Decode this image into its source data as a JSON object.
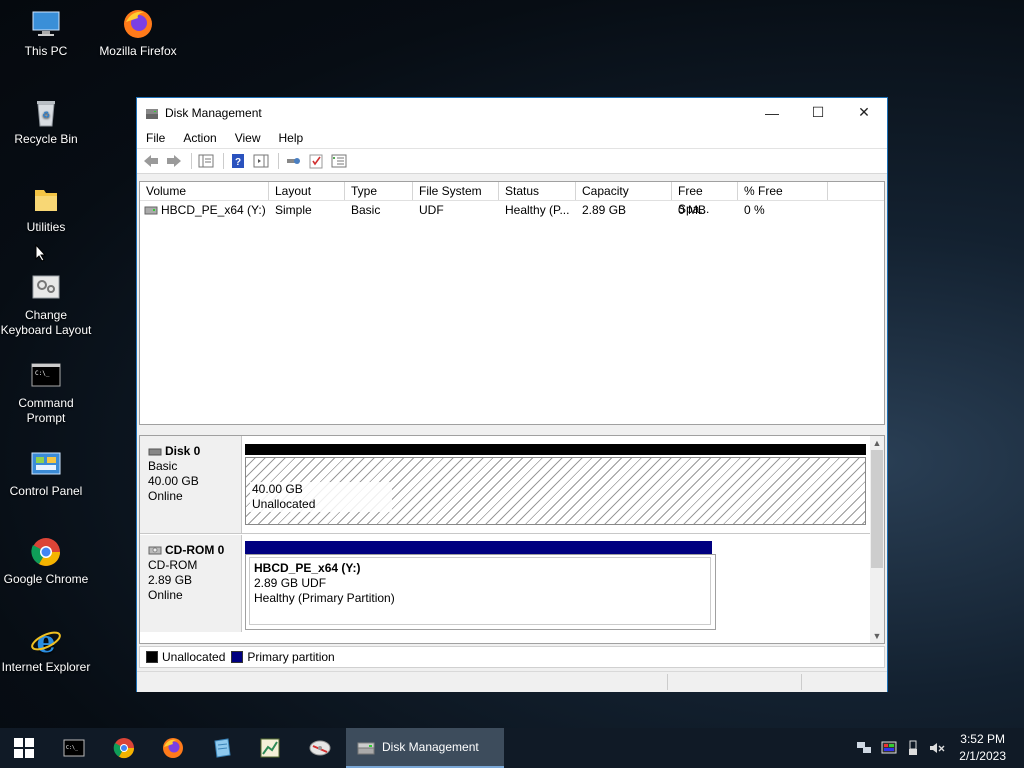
{
  "desktop": {
    "icons": [
      {
        "label": "This PC"
      },
      {
        "label": "Mozilla Firefox"
      },
      {
        "label": "Recycle Bin"
      },
      {
        "label": "Utilities"
      },
      {
        "label": "Change Keyboard Layout"
      },
      {
        "label": "Command Prompt"
      },
      {
        "label": "Control Panel"
      },
      {
        "label": "Google Chrome"
      },
      {
        "label": "Internet Explorer"
      }
    ]
  },
  "window": {
    "title": "Disk Management",
    "minimize_glyph": "—",
    "maximize_glyph": "☐",
    "close_glyph": "✕",
    "menu": [
      "File",
      "Action",
      "View",
      "Help"
    ],
    "columns": [
      "Volume",
      "Layout",
      "Type",
      "File System",
      "Status",
      "Capacity",
      "Free Spa...",
      "% Free"
    ],
    "rows": [
      [
        "HBCD_PE_x64 (Y:)",
        "Simple",
        "Basic",
        "UDF",
        "Healthy (P...",
        "2.89 GB",
        "0 MB",
        "0 %"
      ]
    ],
    "disks": [
      {
        "name": "Disk 0",
        "type": "Basic",
        "size": "40.00 GB",
        "state": "Online",
        "partition": {
          "size": "40.00 GB",
          "desc": "Unallocated"
        }
      },
      {
        "name": "CD-ROM 0",
        "type": "CD-ROM",
        "size": "2.89 GB",
        "state": "Online",
        "partition": {
          "name": "HBCD_PE_x64  (Y:)",
          "size": "2.89 GB UDF",
          "desc": "Healthy (Primary Partition)"
        }
      }
    ],
    "legend": [
      {
        "label": "Unallocated",
        "color": "#000000"
      },
      {
        "label": "Primary partition",
        "color": "#000080"
      }
    ]
  },
  "taskbar": {
    "active_task": "Disk Management",
    "time": "3:52 PM",
    "date": "2/1/2023"
  },
  "colors": {
    "accent": "#1c6fb5",
    "primary_partition": "#000080",
    "unallocated": "#000000"
  }
}
